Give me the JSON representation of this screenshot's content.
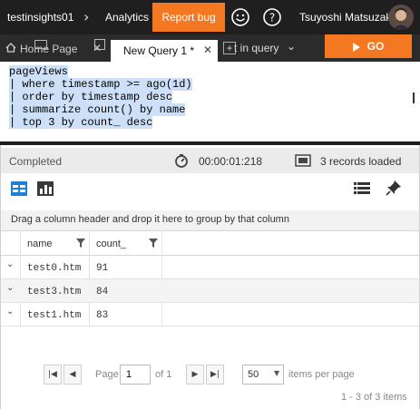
{
  "header": {
    "app_name": "testinsights01",
    "section": "Analytics",
    "report_bug": "Report bug",
    "user_name": "Tsuyoshi Matsuzaki"
  },
  "tabs": {
    "home": "Home Page",
    "query": "New Query 1 *",
    "export_label": "t in query",
    "go_label": "GO"
  },
  "editor": {
    "lines": [
      "pageViews",
      "| where timestamp >= ago(1d)",
      "| order by timestamp desc",
      "| summarize count() by name",
      "| top 3 by count_ desc"
    ]
  },
  "status": {
    "state": "Completed",
    "elapsed": "00:00:01:218",
    "records": "3 records loaded"
  },
  "grid": {
    "group_hint": "Drag a column header and drop it here to group by that column",
    "columns": [
      "name",
      "count_"
    ],
    "rows": [
      {
        "name": "test0.htm",
        "count": "91"
      },
      {
        "name": "test3.htm",
        "count": "84"
      },
      {
        "name": "test1.htm",
        "count": "83"
      }
    ]
  },
  "pager": {
    "page_label": "Page",
    "page_value": "1",
    "of_label": "of 1",
    "page_size": "50",
    "items_per_page": "items per page",
    "items_info": "1 - 3 of 3 items"
  },
  "colors": {
    "accent": "#f47721",
    "header_bg": "#1f1f1f",
    "selection": "#cde0f7",
    "icon_blue": "#1e7fd6"
  }
}
